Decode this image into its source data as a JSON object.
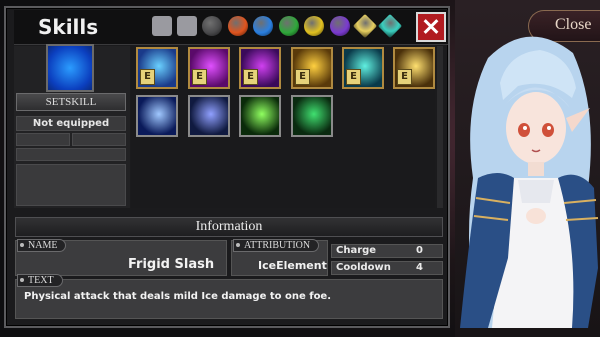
{
  "window": {
    "title": "Skills",
    "close_label": "Close"
  },
  "filters": [
    {
      "icon": "sword-filter-icon",
      "color": "#8a6a3a"
    },
    {
      "icon": "staff-filter-icon",
      "color": "#7a5a2a"
    },
    {
      "icon": "dark-element-icon",
      "color": "#4a4a4c"
    },
    {
      "icon": "fire-element-icon",
      "color": "#e0541e"
    },
    {
      "icon": "water-element-icon",
      "color": "#2a7fe0"
    },
    {
      "icon": "wind-element-icon",
      "color": "#2fa83a"
    },
    {
      "icon": "thunder-element-icon",
      "color": "#e0c020"
    },
    {
      "icon": "poison-element-icon",
      "color": "#7a3ad0"
    },
    {
      "icon": "light-element-icon",
      "color": "#e8d060"
    },
    {
      "icon": "rainbow-element-icon",
      "color": "#3ad0c0"
    }
  ],
  "left": {
    "set_label": "SETSKILL",
    "status": "Not equipped"
  },
  "skills": [
    {
      "icon": "ice-sword-skill-icon",
      "badge": "E",
      "colors": [
        "#1a3a8a",
        "#6ad0ff"
      ]
    },
    {
      "icon": "magic-circle-skill-icon",
      "badge": "E",
      "colors": [
        "#5a0a6a",
        "#e050ff"
      ]
    },
    {
      "icon": "arcane-burst-skill-icon",
      "badge": "E",
      "colors": [
        "#3a0a5a",
        "#d040f0"
      ]
    },
    {
      "icon": "golden-treasure-skill-icon",
      "badge": "E",
      "colors": [
        "#5a3a0a",
        "#ffd040"
      ]
    },
    {
      "icon": "spirit-skill-icon",
      "badge": "E",
      "colors": [
        "#0a3a4a",
        "#60f0e0"
      ]
    },
    {
      "icon": "holy-cross-skill-icon",
      "badge": "E",
      "colors": [
        "#4a300a",
        "#ffe070"
      ]
    },
    {
      "icon": "crescent-moon-skill-icon",
      "badge": "",
      "colors": [
        "#0a1a5a",
        "#a0c8ff"
      ]
    },
    {
      "icon": "eye-pyramid-skill-icon",
      "badge": "",
      "colors": [
        "#101a40",
        "#90a0ff"
      ]
    },
    {
      "icon": "green-slash-skill-icon",
      "badge": "",
      "colors": [
        "#0a2a0a",
        "#90ff60"
      ]
    },
    {
      "icon": "green-arrow-skill-icon",
      "badge": "",
      "colors": [
        "#0a2a10",
        "#40e070"
      ]
    }
  ],
  "info": {
    "header": "Information",
    "name_label": "NAME",
    "name_value": "Frigid Slash",
    "attribution_label": "ATTRIBUTION",
    "attribution_value": "IceElement",
    "charge_label": "Charge",
    "charge_value": "0",
    "cooldown_label": "Cooldown",
    "cooldown_value": "4",
    "text_label": "TEXT",
    "text_value": "Physical attack that deals mild Ice damage to one foe."
  }
}
